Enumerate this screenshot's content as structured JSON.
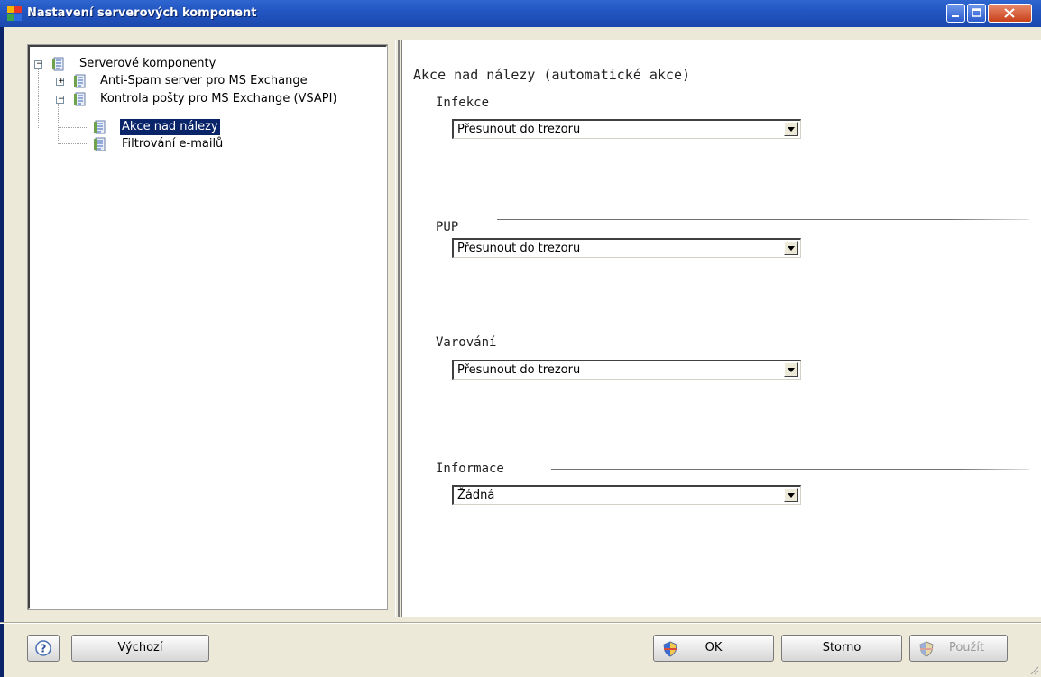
{
  "window": {
    "title": "Nastavení serverových komponent"
  },
  "tree": {
    "items": [
      {
        "label": "Serverové komponenty",
        "expander": "−"
      },
      {
        "label": "Anti-Spam server pro MS Exchange",
        "expander": "+"
      },
      {
        "label": "Kontrola pošty pro MS Exchange (VSAPI)",
        "expander": "−"
      },
      {
        "label": "Akce nad nálezy",
        "selected": true
      },
      {
        "label": "Filtrování e-mailů"
      }
    ]
  },
  "content": {
    "section_title": "Akce nad nálezy (automatické akce)",
    "groups": [
      {
        "label": "Infekce",
        "value": "Přesunout do trezoru"
      },
      {
        "label": "PUP",
        "value": "Přesunout do trezoru"
      },
      {
        "label": "Varování",
        "value": "Přesunout do trezoru"
      },
      {
        "label": "Informace",
        "value": "Žádná"
      }
    ]
  },
  "footer": {
    "help_icon": "question-icon",
    "default_label": "Výchozí",
    "ok_label": "OK",
    "cancel_label": "Storno",
    "apply_label": "Použít"
  },
  "colors": {
    "selection": "#0a246a",
    "titlebar": "#2356c2",
    "dialog_bg": "#ece9d8"
  }
}
